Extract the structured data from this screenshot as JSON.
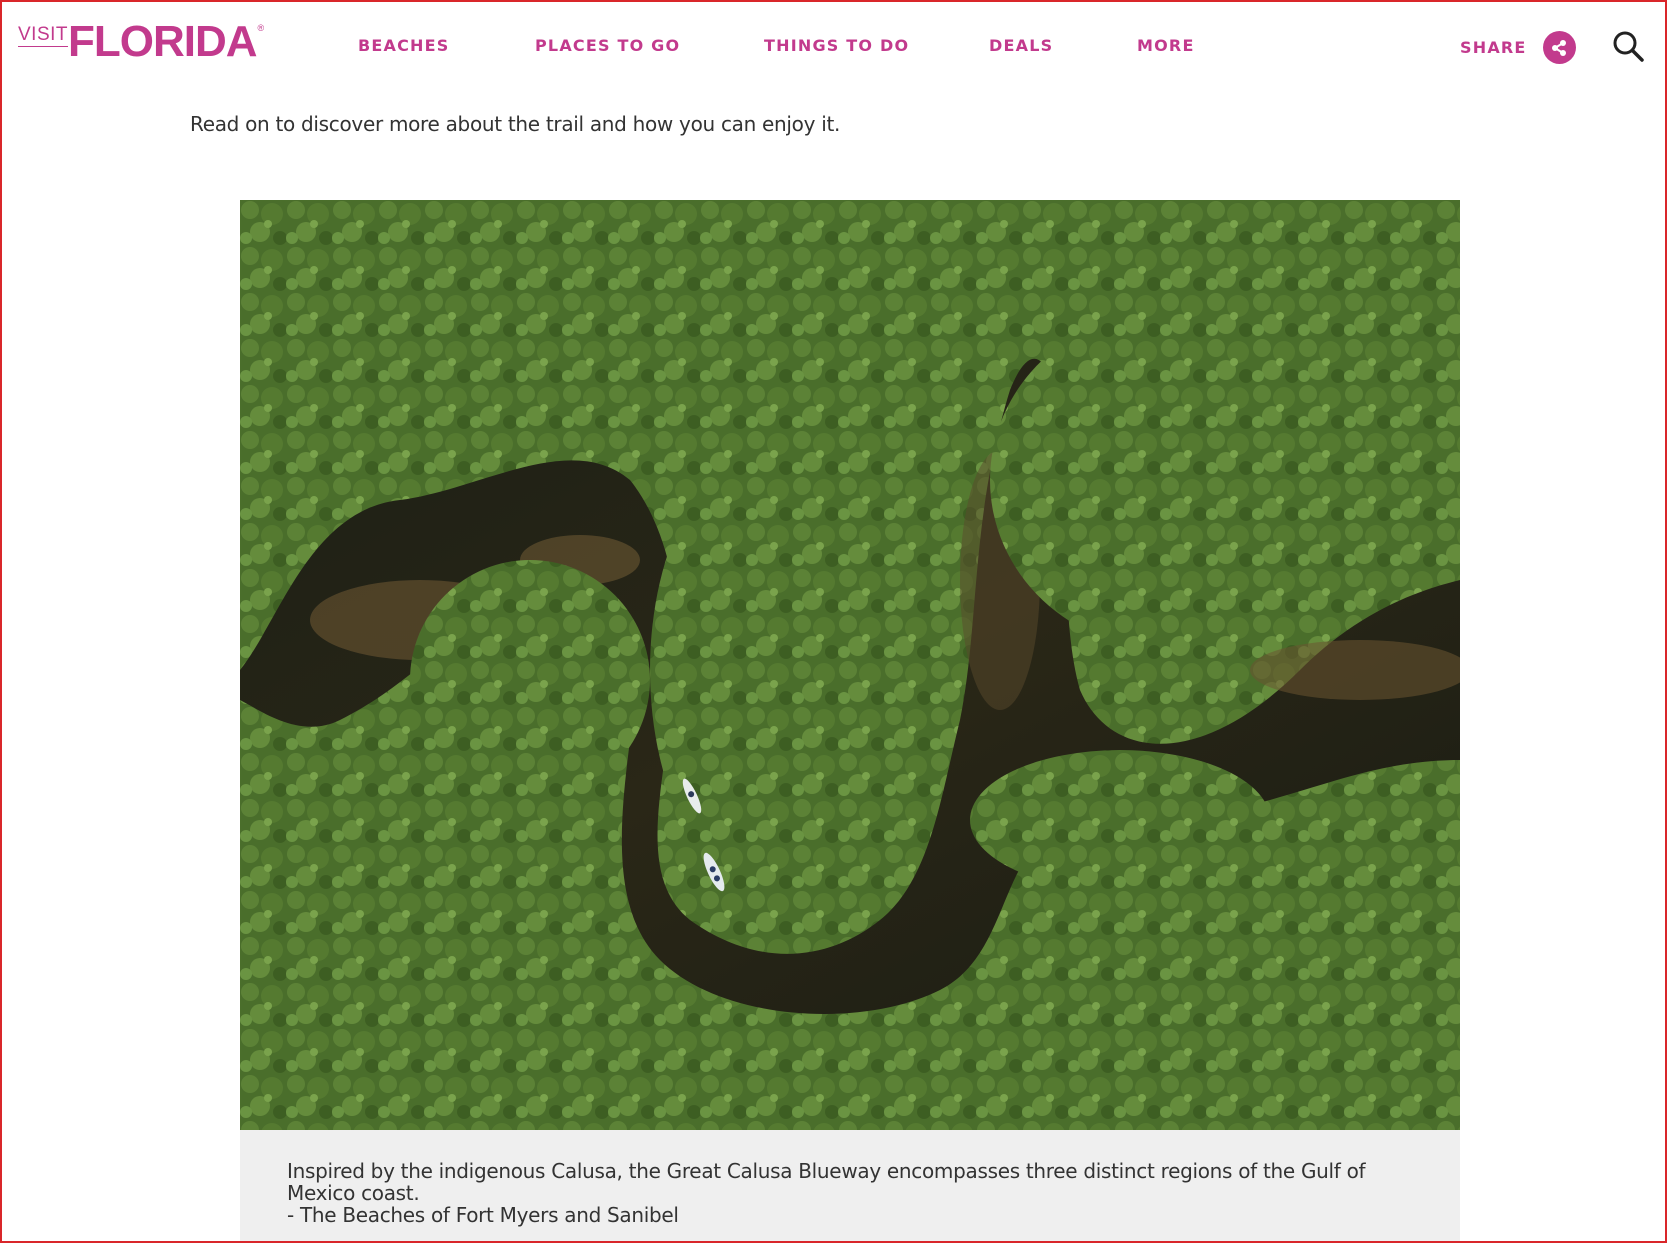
{
  "header": {
    "logo": {
      "visit": "VISIT",
      "brand": "FLORIDA",
      "reg": "®"
    },
    "nav": [
      {
        "label": "BEACHES"
      },
      {
        "label": "PLACES TO GO"
      },
      {
        "label": "THINGS TO DO"
      },
      {
        "label": "DEALS"
      },
      {
        "label": "MORE"
      }
    ],
    "share_label": "SHARE",
    "icons": {
      "share": "share-icon",
      "search": "search-icon"
    }
  },
  "article": {
    "intro": "Read on to discover more about the trail and how you can enjoy it.",
    "image": {
      "subject": "aerial-mangrove-waterway-with-kayaks",
      "kayak_count": 2
    },
    "caption": {
      "line1": "Inspired by the indigenous Calusa, the Great Calusa Blueway encompasses three distinct regions of the Gulf of",
      "line2": "Mexico coast.",
      "credit": "- The Beaches of Fort Myers and Sanibel"
    }
  },
  "colors": {
    "brand": "#c23a8d",
    "text": "#333333",
    "caption_bg": "#efefef",
    "frame": "#d9262a"
  }
}
